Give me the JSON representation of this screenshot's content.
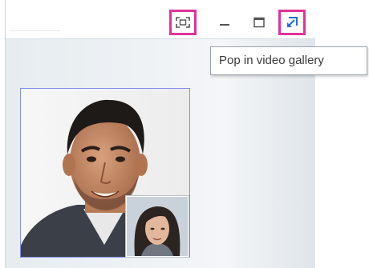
{
  "window": {
    "buttons": [
      {
        "icon": "fullscreen-icon",
        "highlighted": true
      },
      {
        "icon": "minimize-icon",
        "highlighted": false
      },
      {
        "icon": "maximize-icon",
        "highlighted": false
      },
      {
        "icon": "pop-in-icon",
        "highlighted": true
      }
    ]
  },
  "tooltip": {
    "text": "Pop in video gallery"
  },
  "video": {
    "main_participant": "person-portrait",
    "self_view": "person-portrait"
  },
  "colors": {
    "highlight": "#e0339a",
    "accent": "#1f6fd1",
    "video_border": "#7f8ff0"
  }
}
